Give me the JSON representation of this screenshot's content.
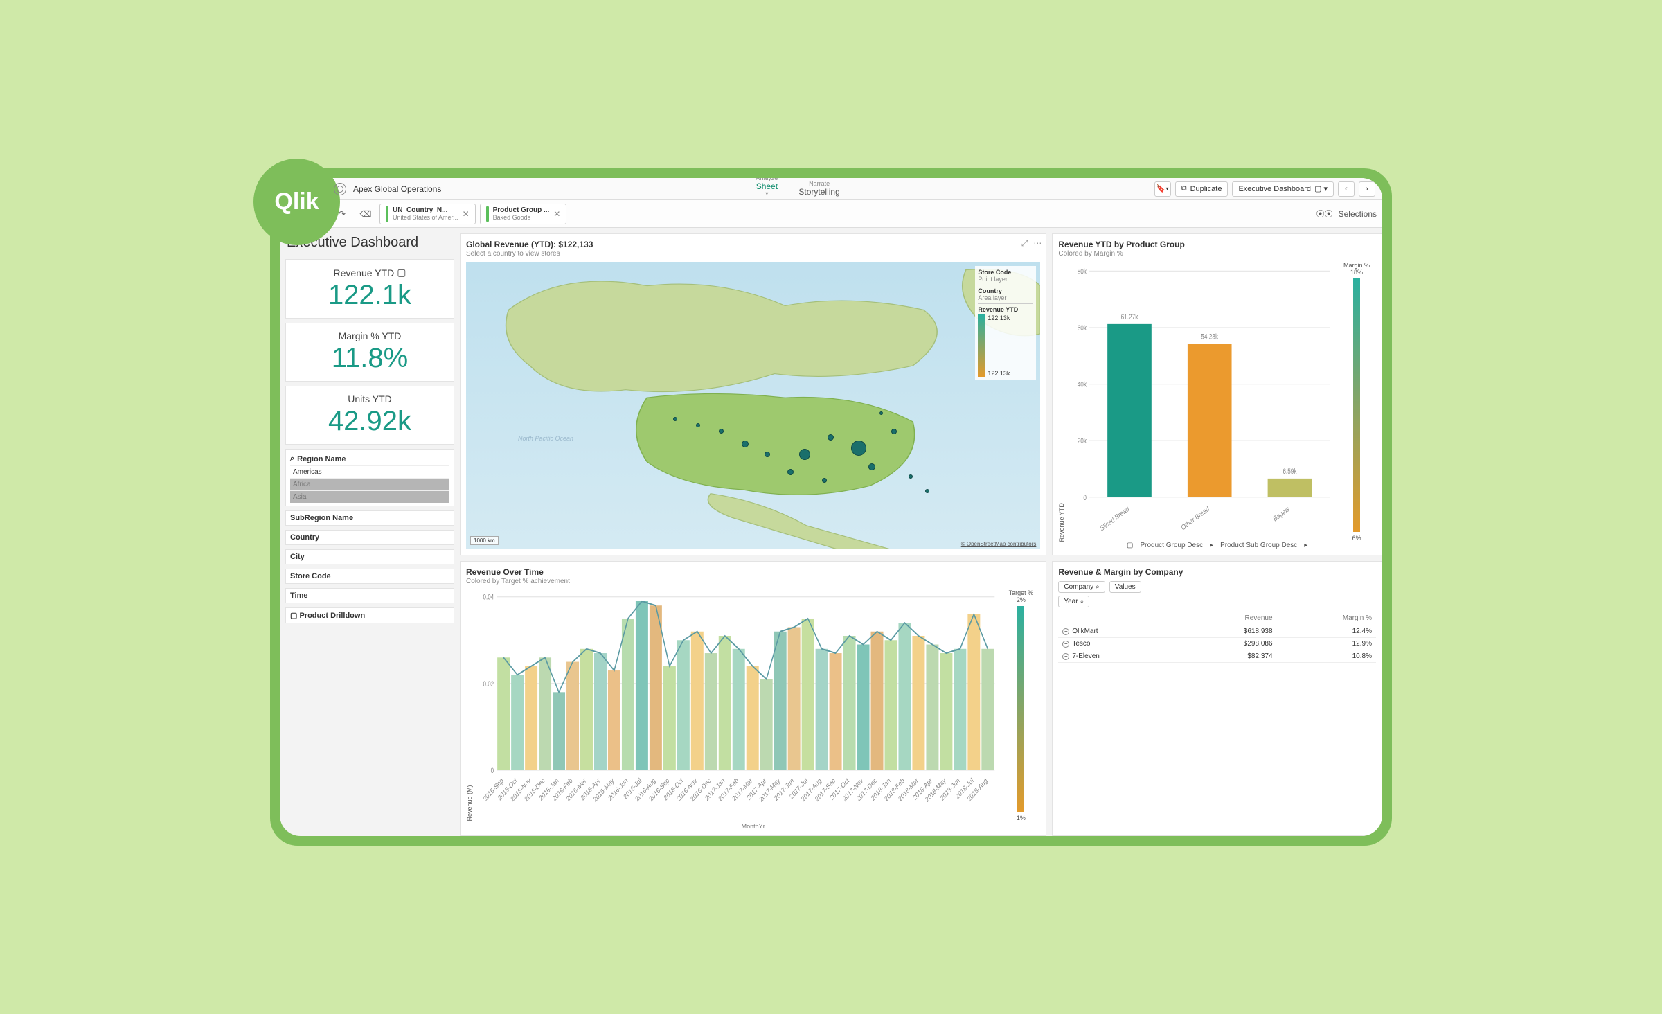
{
  "brand": "Qlik",
  "topbar": {
    "app_name": "Apex Global Operations",
    "analyze_top": "Analyze",
    "analyze_bottom": "Sheet",
    "narrate_top": "Narrate",
    "narrate_bottom": "Storytelling",
    "duplicate": "Duplicate",
    "sheetname": "Executive Dashboard"
  },
  "selbar": {
    "chip1_label": "UN_Country_N...",
    "chip1_sub": "United States of Amer...",
    "chip2_label": "Product Group ...",
    "chip2_sub": "Baked Goods",
    "selections": "Selections"
  },
  "page_title": "Executive Dashboard",
  "kpi": {
    "rev_label": "Revenue YTD",
    "rev_value": "122.1k",
    "margin_label": "Margin % YTD",
    "margin_value": "11.8%",
    "units_label": "Units YTD",
    "units_value": "42.92k"
  },
  "filters": {
    "region_hdr": "Region Name",
    "region_items": [
      "Americas",
      "Africa",
      "Asia"
    ],
    "subregion": "SubRegion Name",
    "country": "Country",
    "city": "City",
    "storecode": "Store Code",
    "time": "Time",
    "drilldown": "Product Drilldown"
  },
  "map": {
    "title": "Global Revenue (YTD): $122,133",
    "subtitle": "Select a country to view stores",
    "legend_store": "Store Code",
    "legend_point": "Point layer",
    "legend_country": "Country",
    "legend_area": "Area layer",
    "legend_rev": "Revenue YTD",
    "legend_top": "122.13k",
    "legend_bot": "122.13k",
    "scale": "1000 km",
    "credit": "OpenStreetMap contributors",
    "ocean": "North Pacific Ocean"
  },
  "bar": {
    "title": "Revenue YTD by Product Group",
    "subtitle": "Colored by Margin %",
    "yaxis": "Revenue YTD",
    "legend_title": "Margin %",
    "legend_top": "18%",
    "legend_bot": "6%",
    "drill1": "Product Group Desc",
    "drill2": "Product Sub Group Desc"
  },
  "area": {
    "title": "Revenue Over Time",
    "subtitle": "Colored by Target % achievement",
    "yaxis": "Revenue (M)",
    "xaxis": "MonthYr",
    "legend_title": "Target %",
    "legend_top": "2%",
    "legend_bot": "1%"
  },
  "table": {
    "title": "Revenue & Margin by Company",
    "pill_company": "Company",
    "pill_values": "Values",
    "pill_year": "Year",
    "col_rev": "Revenue",
    "col_margin": "Margin %"
  },
  "chart_data": [
    {
      "id": "revenue_by_product_group",
      "type": "bar",
      "ylabel": "Revenue YTD",
      "ylim": [
        0,
        80000
      ],
      "yticks": [
        0,
        20000,
        40000,
        60000,
        80000
      ],
      "ytick_labels": [
        "0",
        "20k",
        "40k",
        "60k",
        "80k"
      ],
      "categories": [
        "Sliced Bread",
        "Other Bread",
        "Bagels"
      ],
      "values": [
        61270,
        54280,
        6590
      ],
      "value_labels": [
        "61.27k",
        "54.28k",
        "6.59k"
      ],
      "colors": [
        "#1a9a86",
        "#eb9a2e",
        "#bfbf63"
      ],
      "color_legend": {
        "label": "Margin %",
        "min": 6,
        "max": 18
      }
    },
    {
      "id": "revenue_over_time",
      "type": "area",
      "xlabel": "MonthYr",
      "ylabel": "Revenue (M)",
      "ylim": [
        0,
        0.04
      ],
      "yticks": [
        0,
        0.02,
        0.04
      ],
      "categories": [
        "2015-Sep",
        "2015-Oct",
        "2015-Nov",
        "2015-Dec",
        "2016-Jan",
        "2016-Feb",
        "2016-Mar",
        "2016-Apr",
        "2016-May",
        "2016-Jun",
        "2016-Jul",
        "2016-Aug",
        "2016-Sep",
        "2016-Oct",
        "2016-Nov",
        "2016-Dec",
        "2017-Jan",
        "2017-Feb",
        "2017-Mar",
        "2017-Apr",
        "2017-May",
        "2017-Jun",
        "2017-Jul",
        "2017-Aug",
        "2017-Sep",
        "2017-Oct",
        "2017-Nov",
        "2017-Dec",
        "2018-Jan",
        "2018-Feb",
        "2018-Mar",
        "2018-Apr",
        "2018-May",
        "2018-Jun",
        "2018-Jul",
        "2018-Aug"
      ],
      "values": [
        0.026,
        0.022,
        0.024,
        0.026,
        0.018,
        0.025,
        0.028,
        0.027,
        0.023,
        0.035,
        0.039,
        0.038,
        0.024,
        0.03,
        0.032,
        0.027,
        0.031,
        0.028,
        0.024,
        0.021,
        0.032,
        0.033,
        0.035,
        0.028,
        0.027,
        0.031,
        0.029,
        0.032,
        0.03,
        0.034,
        0.031,
        0.029,
        0.027,
        0.028,
        0.036,
        0.028
      ],
      "color_legend": {
        "label": "Target %",
        "min": 1,
        "max": 2
      }
    },
    {
      "id": "revenue_margin_by_company",
      "type": "table",
      "columns": [
        "Company",
        "Revenue",
        "Margin %"
      ],
      "rows": [
        {
          "company": "QlikMart",
          "revenue": "$618,938",
          "margin": "12.4%"
        },
        {
          "company": "Tesco",
          "revenue": "$298,086",
          "margin": "12.9%"
        },
        {
          "company": "7-Eleven",
          "revenue": "$82,374",
          "margin": "10.8%"
        }
      ]
    },
    {
      "id": "global_revenue_map",
      "type": "map",
      "title": "Global Revenue (YTD): $122,133",
      "area_layer": "Country",
      "point_layer": "Store Code",
      "metric": "Revenue YTD",
      "metric_range": [
        122130,
        122130
      ]
    }
  ]
}
